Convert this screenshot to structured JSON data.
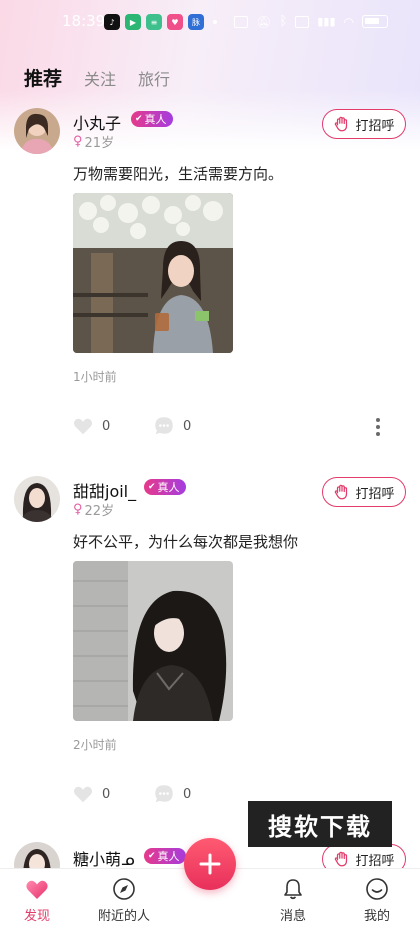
{
  "status_bar": {
    "time": "18:39",
    "apps": [
      {
        "icon": "tiktok-icon",
        "color": "#111111",
        "glyph": "♪"
      },
      {
        "icon": "video-play-icon",
        "color": "#2bb673",
        "glyph": "▶"
      },
      {
        "icon": "list-app-icon",
        "color": "#3dc08c",
        "glyph": "≡"
      },
      {
        "icon": "pink-app-icon",
        "color": "#f0508a",
        "glyph": "♥"
      },
      {
        "icon": "blue-app-icon",
        "color": "#2f6fd6",
        "glyph": "脉"
      }
    ]
  },
  "tabs": [
    {
      "label": "推荐",
      "active": true
    },
    {
      "label": "关注",
      "active": false
    },
    {
      "label": "旅行",
      "active": false
    }
  ],
  "badge_label": "真人",
  "greet_label": "打招呼",
  "posts": [
    {
      "username": "小丸子",
      "age": "21岁",
      "text": "万物需要阳光，生活需要方向。",
      "time": "1小时前",
      "likes": "0",
      "comments": "0"
    },
    {
      "username": "甜甜joil_",
      "age": "22岁",
      "text": "好不公平，为什么每次都是我想你",
      "time": "2小时前",
      "likes": "0",
      "comments": "0"
    },
    {
      "username": "糖小萌ᓄ"
    }
  ],
  "watermark": "搜软下载",
  "nav": [
    {
      "label": "发现",
      "icon": "heart-discover-icon",
      "active": true
    },
    {
      "label": "附近的人",
      "icon": "compass-icon",
      "active": false
    },
    {
      "label": "消息",
      "icon": "bell-icon",
      "active": false
    },
    {
      "label": "我的",
      "icon": "profile-bubble-icon",
      "active": false
    }
  ],
  "colors": {
    "accent": "#e23c6b",
    "badge": "#c73cc0"
  }
}
